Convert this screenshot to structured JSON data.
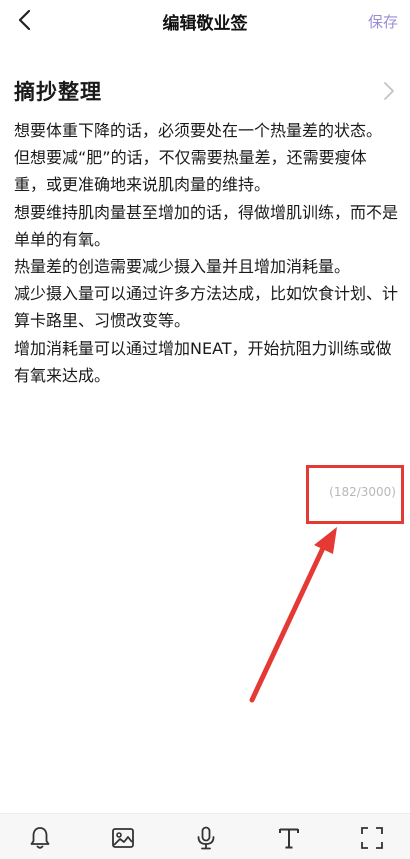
{
  "header": {
    "back_icon": "chevron-left-icon",
    "title": "编辑敬业签",
    "save_label": "保存"
  },
  "category": {
    "title": "摘抄整理",
    "chevron_icon": "chevron-right-icon"
  },
  "note": {
    "text": "想要体重下降的话，必须要处在一个热量差的状态。\n但想要减“肥”的话，不仅需要热量差，还需要瘦体重，或更准确地来说肌肉量的维持。\n想要维持肌肉量甚至增加的话，得做增肌训练，而不是单单的有氧。\n热量差的创造需要减少摄入量并且增加消耗量。\n减少摄入量可以通过许多方法达成，比如饮食计划、计算卡路里、习惯改变等。\n增加消耗量可以通过增加NEAT，开始抗阻力训练或做有氧来达成。",
    "char_count": "(182/3000)"
  },
  "annotation": {
    "color": "#e53935"
  },
  "toolbar": {
    "items": [
      {
        "icon": "bell-icon"
      },
      {
        "icon": "image-icon"
      },
      {
        "icon": "microphone-icon"
      },
      {
        "icon": "text-format-icon"
      },
      {
        "icon": "fullscreen-icon"
      }
    ]
  },
  "colors": {
    "accent": "#9a8fd6",
    "text": "#1a1a1a",
    "counter": "#b8b8b8"
  }
}
